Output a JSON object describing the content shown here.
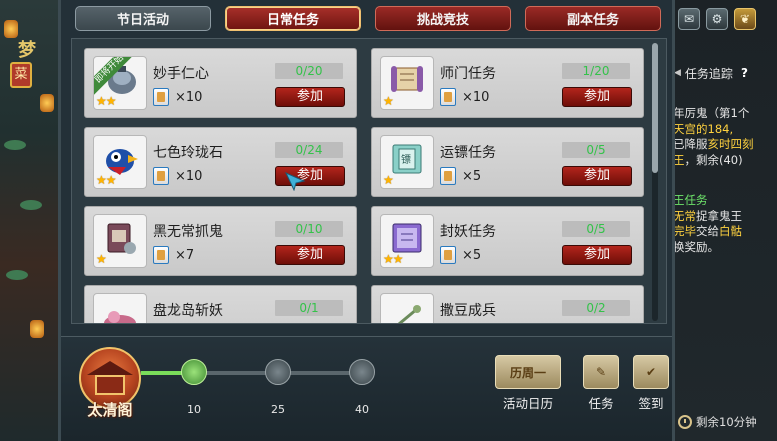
{
  "tabs": [
    {
      "label": "节日活动",
      "state": "normal"
    },
    {
      "label": "日常任务",
      "state": "active"
    },
    {
      "label": "挑战竞技",
      "state": "normal"
    },
    {
      "label": "副本任务",
      "state": "normal"
    }
  ],
  "quests": [
    {
      "name": "妙手仁心",
      "progress": "0/20",
      "reward_qty": "×10",
      "button": "参加",
      "stars": "★★",
      "ribbon": "即将开始",
      "icon": "medicine-pot-icon"
    },
    {
      "name": "师门任务",
      "progress": "1/20",
      "reward_qty": "×10",
      "button": "参加",
      "stars": "★",
      "icon": "scroll-icon"
    },
    {
      "name": "七色玲珑石",
      "progress": "0/24",
      "reward_qty": "×10",
      "button": "参加",
      "stars": "★★",
      "icon": "parrot-icon"
    },
    {
      "name": "运镖任务",
      "progress": "0/5",
      "reward_qty": "×5",
      "button": "参加",
      "stars": "★",
      "icon": "escort-book-icon"
    },
    {
      "name": "黑无常抓鬼",
      "progress": "0/10",
      "reward_qty": "×7",
      "button": "参加",
      "stars": "★",
      "icon": "ghost-tablet-icon"
    },
    {
      "name": "封妖任务",
      "progress": "0/5",
      "reward_qty": "×5",
      "button": "参加",
      "stars": "★★",
      "icon": "seal-book-icon"
    },
    {
      "name": "盘龙岛斩妖",
      "progress": "0/1",
      "icon": "dragon-island-icon"
    },
    {
      "name": "撒豆成兵",
      "progress": "0/2",
      "icon": "beans-icon"
    }
  ],
  "bottom": {
    "emblem_label": "太清阁",
    "milestones": [
      "10",
      "25",
      "40"
    ],
    "progress_fraction": 0.22,
    "calendar_icon_text": "历周一",
    "calendar_label": "活动日历",
    "task_label": "任务",
    "signin_label": "签到"
  },
  "tracker": {
    "title": "任务追踪",
    "help": "?",
    "lines": [
      {
        "text": "年厉鬼（第1个",
        "color": "white"
      },
      {
        "text": "天宫的184,",
        "color": "yellow"
      },
      {
        "text": "已降服",
        "color": "white",
        "extra": "亥时四刻"
      },
      {
        "text": "王",
        "color": "yellow",
        "extra": "，剩余(40)"
      }
    ],
    "lines2": [
      {
        "text": "王任务",
        "color": "green"
      },
      {
        "text": "无常",
        "color": "yellow",
        "extra": "捉拿鬼王"
      },
      {
        "text": "完毕",
        "color": "yellow",
        "extra": "交给",
        "extra2": "白骷"
      },
      {
        "text": "换奖励。",
        "color": "white"
      }
    ],
    "timer": "剩余10分钟"
  },
  "left_decor": {
    "char1": "梦",
    "char2": "菜"
  },
  "colors": {
    "progress_text": "#34c24a",
    "join_button": "#b3251c",
    "active_tab": "#a8302a",
    "star": "#ffb400"
  }
}
